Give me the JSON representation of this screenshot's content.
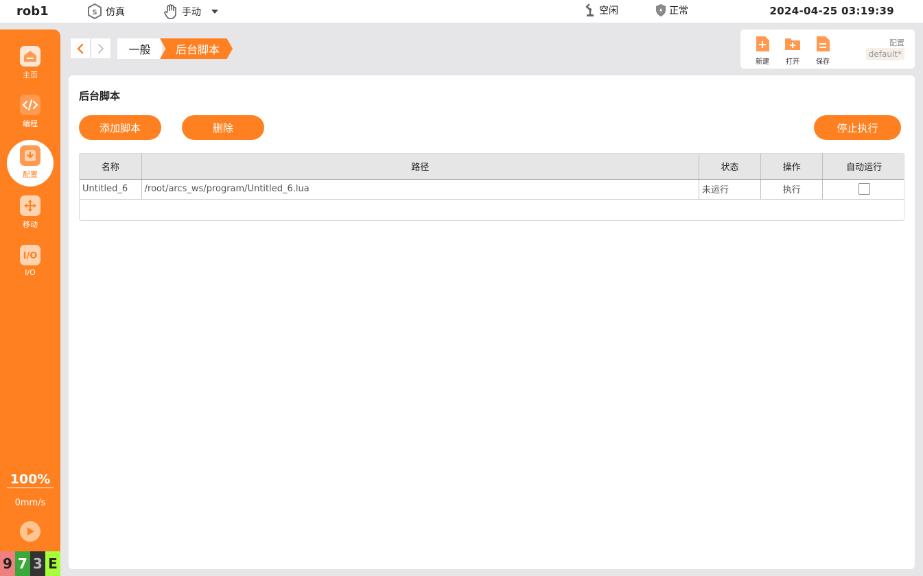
{
  "topbar": {
    "robot_name": "rob1",
    "sim_label": "仿真",
    "mode_label": "手动",
    "idle_label": "空闲",
    "normal_label": "正常",
    "datetime": "2024-04-25 03:19:39"
  },
  "sidebar": {
    "items": [
      {
        "label": "主页",
        "icon": "home-icon"
      },
      {
        "label": "编程",
        "icon": "code-icon"
      },
      {
        "label": "配置",
        "icon": "config-icon"
      },
      {
        "label": "移动",
        "icon": "move-icon"
      },
      {
        "label": "I/O",
        "icon": "io-icon"
      }
    ],
    "speed_percent": "100%",
    "speed_value": "0mm/s",
    "status_chars": [
      "9",
      "7",
      "3",
      "E"
    ]
  },
  "breadcrumb": {
    "parent": "一般",
    "current": "后台脚本"
  },
  "toolbar": {
    "new_label": "新建",
    "open_label": "打开",
    "save_label": "保存",
    "config_label": "配置",
    "config_value": "default*"
  },
  "panel": {
    "title": "后台脚本",
    "add_button": "添加脚本",
    "delete_button": "删除",
    "stop_button": "停止执行",
    "table": {
      "headers": [
        "名称",
        "路径",
        "状态",
        "操作",
        "自动运行"
      ],
      "rows": [
        {
          "name": "Untitled_6",
          "path": "/root/arcs_ws/program/Untitled_6.lua",
          "status": "未运行",
          "action": "执行",
          "auto_run": false
        }
      ]
    }
  },
  "colors": {
    "accent": "#ff8020",
    "background": "#e6e6e8"
  }
}
